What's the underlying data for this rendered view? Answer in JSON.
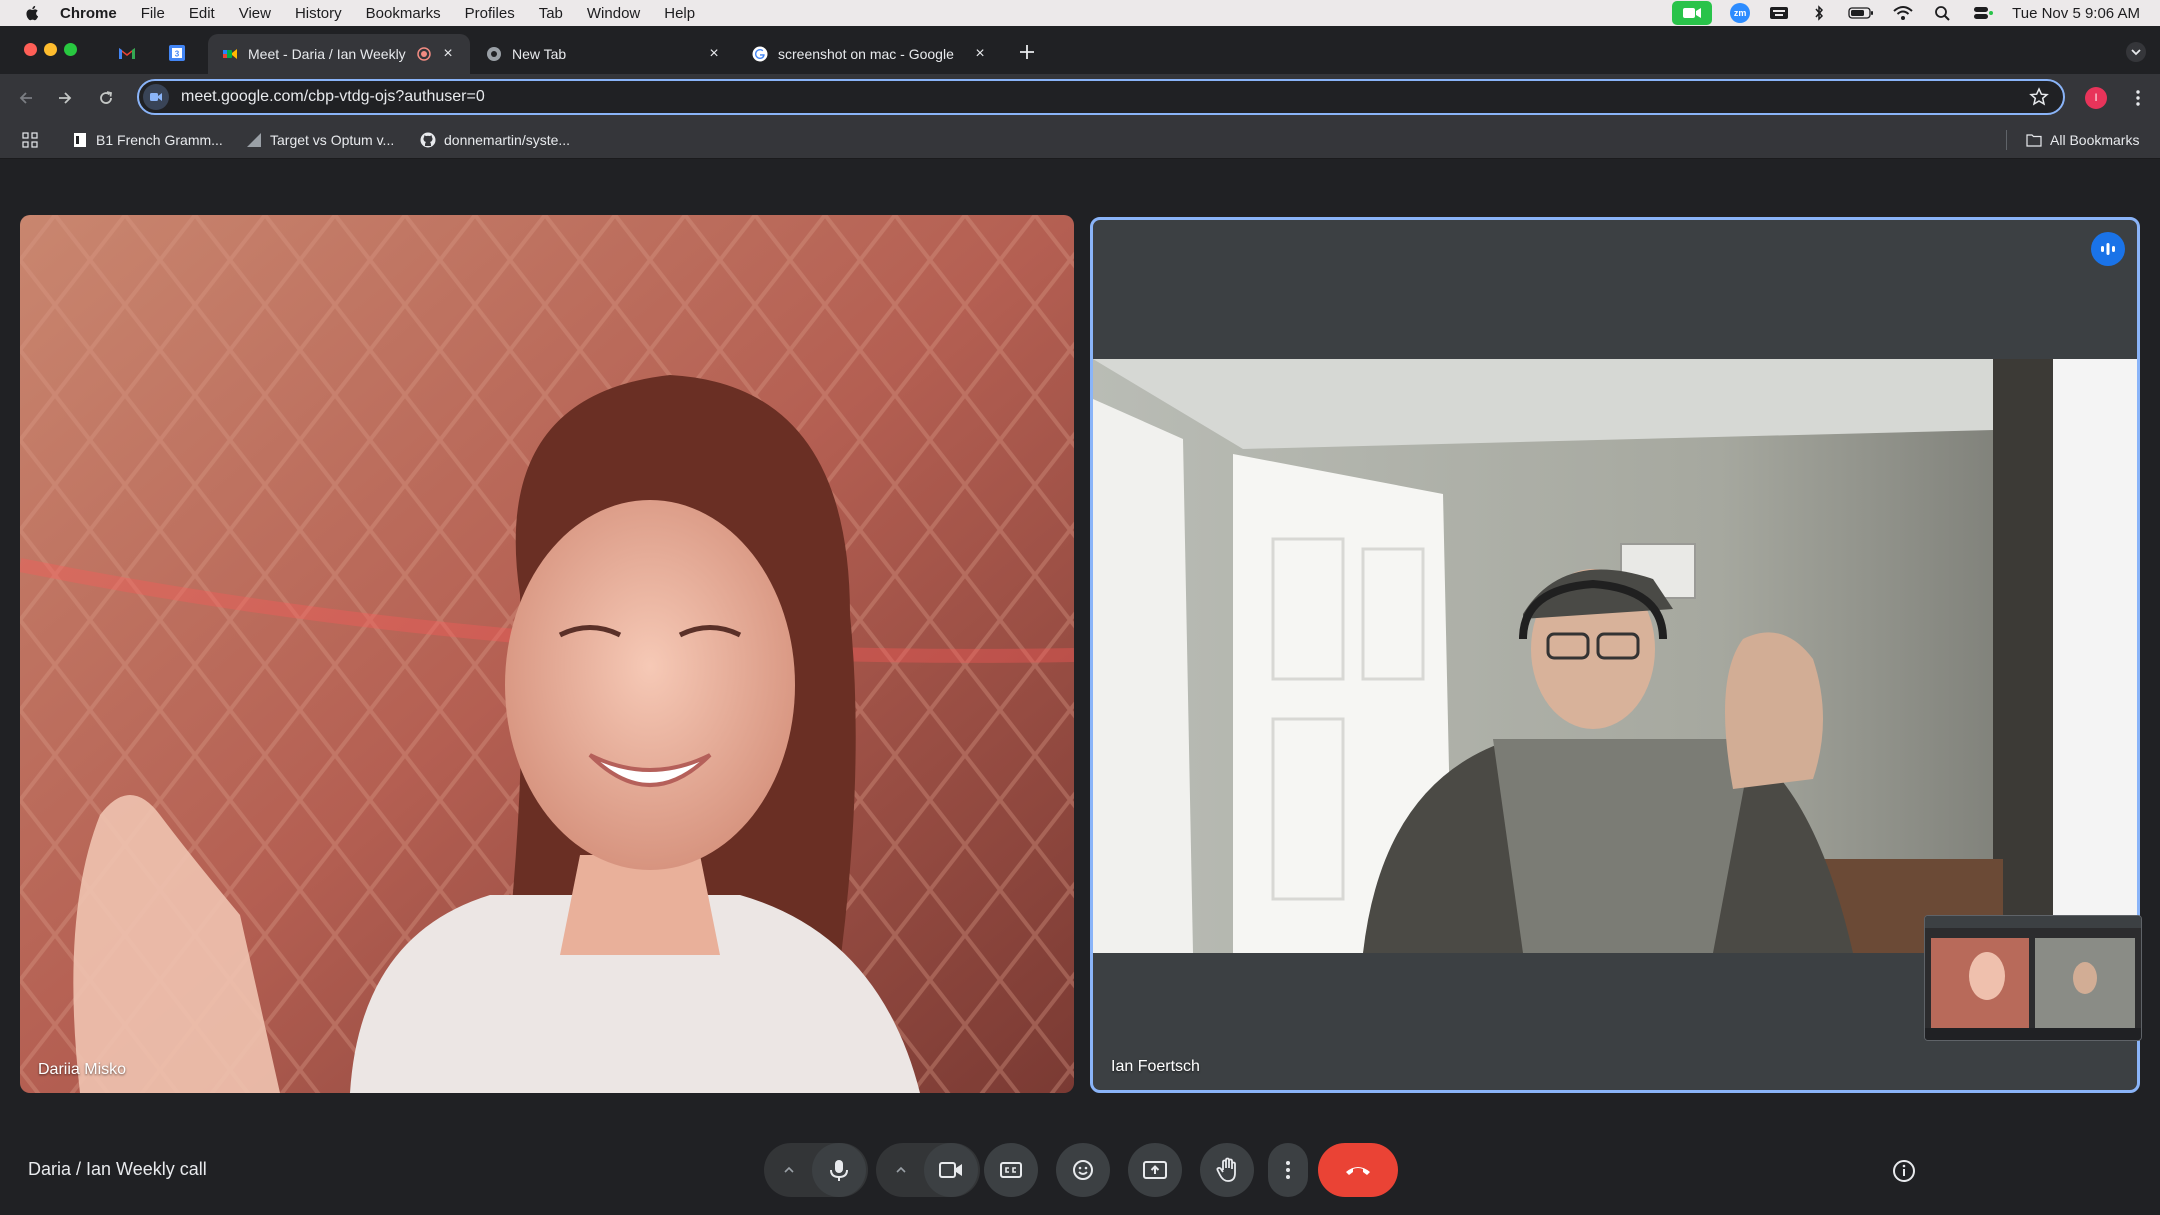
{
  "menubar": {
    "app_name": "Chrome",
    "items": [
      "File",
      "Edit",
      "View",
      "History",
      "Bookmarks",
      "Profiles",
      "Tab",
      "Window",
      "Help"
    ],
    "clock": "Tue Nov 5  9:06 AM"
  },
  "tabs": {
    "active_title": "Meet - Daria / Ian Weekly",
    "new_tab_title": "New Tab",
    "search_tab_title": "screenshot on mac - Google"
  },
  "address_bar": {
    "url": "meet.google.com/cbp-vtdg-ojs?authuser=0"
  },
  "bookmarks": {
    "items": [
      "B1 French Gramm...",
      "Target vs Optum v...",
      "donnemartin/syste..."
    ],
    "all_label": "All Bookmarks"
  },
  "profile": {
    "initial": "I"
  },
  "meeting": {
    "title": "Daria / Ian Weekly call",
    "participants": [
      {
        "name": "Dariia Misko"
      },
      {
        "name": "Ian Foertsch"
      }
    ]
  },
  "colors": {
    "accent": "#8ab4f8",
    "end_call": "#ea4335",
    "speaking": "#1a73e8"
  }
}
